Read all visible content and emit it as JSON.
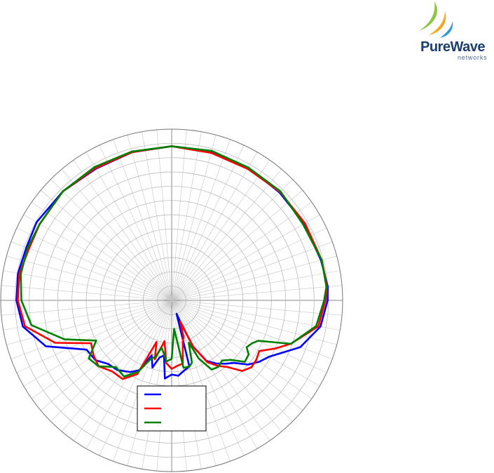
{
  "logo": {
    "word": "PureWave",
    "sub": "networks",
    "colors": [
      "#8dc63f",
      "#f7a823",
      "#2e9bd6"
    ]
  },
  "chart_data": {
    "type": "polar",
    "title": "",
    "angle_unit": "deg",
    "r_range": [
      0,
      12
    ],
    "rings": 12,
    "spokes_every_deg": 5,
    "grid": true,
    "legend_placement": "bottom-center",
    "series": [
      {
        "color": "#0000ff",
        "points": [
          [
            0,
            10.8
          ],
          [
            15,
            10.8
          ],
          [
            30,
            10.75
          ],
          [
            45,
            10.7
          ],
          [
            60,
            10.75
          ],
          [
            75,
            10.85
          ],
          [
            85,
            11.0
          ],
          [
            90,
            10.95
          ],
          [
            100,
            10.6
          ],
          [
            110,
            9.6
          ],
          [
            120,
            7.9
          ],
          [
            125,
            7.5
          ],
          [
            130,
            7.0
          ],
          [
            135,
            6.2
          ],
          [
            140,
            5.8
          ],
          [
            145,
            5.4
          ],
          [
            150,
            4.9
          ],
          [
            155,
            3.6
          ],
          [
            158,
            1.8
          ],
          [
            160,
            1.0
          ],
          [
            165,
            4.8
          ],
          [
            170,
            5.0
          ],
          [
            175,
            5.3
          ],
          [
            180,
            5.2
          ],
          [
            185,
            5.5
          ],
          [
            188,
            3.9
          ],
          [
            192,
            4.1
          ],
          [
            196,
            4.9
          ],
          [
            200,
            4.1
          ],
          [
            205,
            5.4
          ],
          [
            210,
            5.8
          ],
          [
            218,
            6.2
          ],
          [
            225,
            6.3
          ],
          [
            232,
            6.8
          ],
          [
            240,
            6.9
          ],
          [
            250,
            9.4
          ],
          [
            260,
            10.6
          ],
          [
            270,
            10.9
          ],
          [
            280,
            10.95
          ],
          [
            290,
            10.85
          ],
          [
            300,
            10.95
          ],
          [
            315,
            10.8
          ],
          [
            330,
            10.65
          ],
          [
            345,
            10.75
          ],
          [
            360,
            10.8
          ]
        ]
      },
      {
        "color": "#ff0000",
        "points": [
          [
            0,
            10.8
          ],
          [
            15,
            10.7
          ],
          [
            30,
            10.65
          ],
          [
            45,
            10.75
          ],
          [
            60,
            10.8
          ],
          [
            75,
            10.9
          ],
          [
            85,
            10.95
          ],
          [
            90,
            10.8
          ],
          [
            100,
            10.45
          ],
          [
            110,
            8.9
          ],
          [
            115,
            8.0
          ],
          [
            120,
            7.1
          ],
          [
            125,
            7.25
          ],
          [
            130,
            7.3
          ],
          [
            135,
            7.0
          ],
          [
            140,
            6.1
          ],
          [
            145,
            5.6
          ],
          [
            150,
            5.0
          ],
          [
            155,
            3.6
          ],
          [
            158,
            1.6
          ],
          [
            162,
            2.7
          ],
          [
            165,
            3.0
          ],
          [
            170,
            4.5
          ],
          [
            175,
            4.6
          ],
          [
            180,
            4.8
          ],
          [
            185,
            4.4
          ],
          [
            190,
            2.9
          ],
          [
            196,
            4.3
          ],
          [
            200,
            3.1
          ],
          [
            205,
            5.7
          ],
          [
            212,
            6.5
          ],
          [
            220,
            6.5
          ],
          [
            228,
            6.9
          ],
          [
            235,
            6.7
          ],
          [
            242,
            6.4
          ],
          [
            250,
            8.7
          ],
          [
            260,
            10.45
          ],
          [
            270,
            10.8
          ],
          [
            280,
            10.85
          ],
          [
            290,
            10.65
          ],
          [
            300,
            10.7
          ],
          [
            315,
            10.8
          ],
          [
            330,
            10.7
          ],
          [
            345,
            10.75
          ],
          [
            360,
            10.8
          ]
        ]
      },
      {
        "color": "#008000",
        "points": [
          [
            0,
            10.8
          ],
          [
            15,
            10.85
          ],
          [
            30,
            10.75
          ],
          [
            45,
            10.8
          ],
          [
            60,
            10.65
          ],
          [
            75,
            10.9
          ],
          [
            85,
            10.9
          ],
          [
            90,
            10.7
          ],
          [
            100,
            10.3
          ],
          [
            110,
            8.9
          ],
          [
            115,
            6.7
          ],
          [
            118,
            6.4
          ],
          [
            122,
            6.2
          ],
          [
            125,
            6.6
          ],
          [
            130,
            6.7
          ],
          [
            135,
            5.9
          ],
          [
            140,
            5.5
          ],
          [
            145,
            5.7
          ],
          [
            150,
            5.6
          ],
          [
            155,
            4.5
          ],
          [
            158,
            3.2
          ],
          [
            162,
            4.6
          ],
          [
            165,
            4.8
          ],
          [
            170,
            4.8
          ],
          [
            175,
            2.0
          ],
          [
            180,
            4.1
          ],
          [
            185,
            4.3
          ],
          [
            188,
            3.8
          ],
          [
            192,
            3.4
          ],
          [
            196,
            4.1
          ],
          [
            200,
            4.4
          ],
          [
            205,
            5.5
          ],
          [
            212,
            6.3
          ],
          [
            220,
            6.1
          ],
          [
            228,
            6.9
          ],
          [
            235,
            7.1
          ],
          [
            242,
            6.0
          ],
          [
            250,
            8.0
          ],
          [
            260,
            10.0
          ],
          [
            270,
            10.55
          ],
          [
            280,
            10.75
          ],
          [
            290,
            10.75
          ],
          [
            300,
            10.7
          ],
          [
            315,
            10.8
          ],
          [
            330,
            10.8
          ],
          [
            345,
            10.8
          ],
          [
            360,
            10.8
          ]
        ]
      }
    ]
  }
}
